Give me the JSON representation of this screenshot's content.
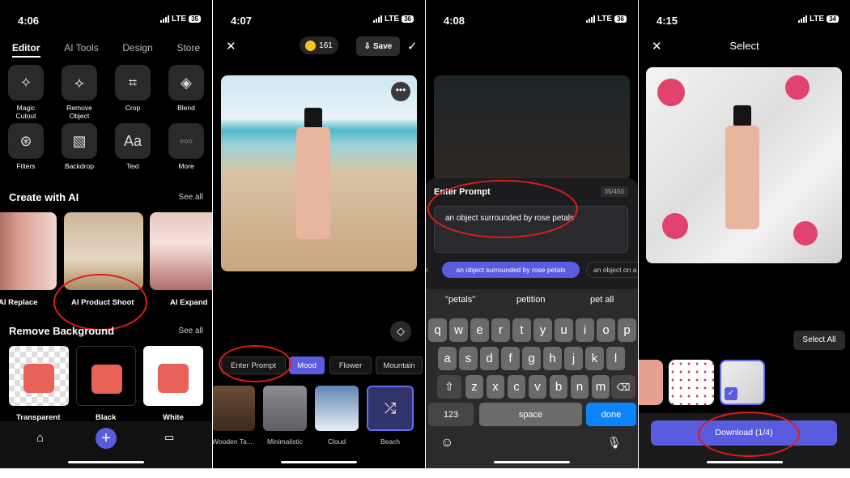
{
  "panel1": {
    "time": "4:06",
    "network": "LTE",
    "battery": "35",
    "tabs": [
      "Editor",
      "AI Tools",
      "Design",
      "Store"
    ],
    "tools": [
      {
        "icon": "magic-cutout-icon",
        "label": "Magic\nCutout"
      },
      {
        "icon": "remove-object-icon",
        "label": "Remove\nObject"
      },
      {
        "icon": "crop-icon",
        "label": "Crop"
      },
      {
        "icon": "blend-icon",
        "label": "Blend"
      },
      {
        "icon": "filters-icon",
        "label": "Filters"
      },
      {
        "icon": "backdrop-icon",
        "label": "Backdrop"
      },
      {
        "icon": "text-icon",
        "label": "Text"
      },
      {
        "icon": "more-icon",
        "label": "More"
      }
    ],
    "create_title": "Create with AI",
    "create_see_all": "See all",
    "ai_cards": [
      "AI Replace",
      "AI Product Shoot",
      "AI Expand"
    ],
    "remove_title": "Remove Background",
    "remove_see_all": "See all",
    "bg_options": [
      "Transparent",
      "Black",
      "White"
    ],
    "text_glyph": "Aa",
    "more_glyph": "○○○"
  },
  "panel2": {
    "time": "4:07",
    "network": "LTE",
    "battery": "36",
    "coins": "161",
    "save_label": "Save",
    "chips": [
      "Enter Prompt",
      "Mood",
      "Flower",
      "Mountain"
    ],
    "presets": [
      "Wooden Ta...",
      "Minimalistic",
      "Cloud",
      "Beach"
    ]
  },
  "panel3": {
    "time": "4:08",
    "network": "LTE",
    "battery": "36",
    "sheet_title": "Enter Prompt",
    "char_count": "35/450",
    "prompt_value": "an object surrounded by rose petals",
    "suggestion_left": "r",
    "suggestion_selected": "an object surrounded by rose petals",
    "suggestion_right": "an object on a",
    "predictions": [
      "\"petals\"",
      "petition",
      "pet all"
    ],
    "row1": [
      "q",
      "w",
      "e",
      "r",
      "t",
      "y",
      "u",
      "i",
      "o",
      "p"
    ],
    "row2": [
      "a",
      "s",
      "d",
      "f",
      "g",
      "h",
      "j",
      "k",
      "l"
    ],
    "row3": [
      "z",
      "x",
      "c",
      "v",
      "b",
      "n",
      "m"
    ],
    "num_key": "123",
    "space_key": "space",
    "done_key": "done"
  },
  "panel4": {
    "time": "4:15",
    "network": "LTE",
    "battery": "34",
    "title": "Select",
    "select_all": "Select All",
    "download_label": "Download (1/4)"
  },
  "colors": {
    "accent": "#5a5ce0",
    "ring": "#e01b1b",
    "keyboard_done": "#0a84ff"
  }
}
